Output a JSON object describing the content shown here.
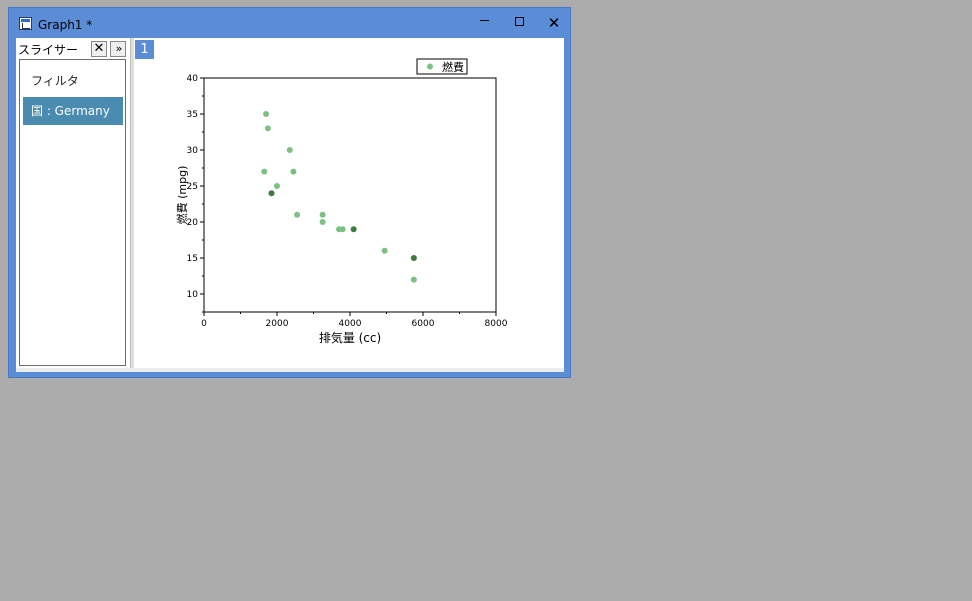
{
  "window": {
    "title": "Graph1 *",
    "min_glyph": "",
    "max_glyph": "",
    "close_glyph": "✕"
  },
  "slicer": {
    "title": "スライサー",
    "close_label": "✕",
    "expand_label": "»",
    "filter_label": "フィルタ",
    "selected_item": "国 : Germany"
  },
  "graph": {
    "layer_label": "1"
  },
  "colors": {
    "window_frame": "#5b8cd6",
    "point_light": "#7dc082",
    "point_dark": "#3f7a3a",
    "selection": "#4a8bb0"
  },
  "chart_data": {
    "type": "scatter",
    "xlabel": "排気量 (cc)",
    "ylabel": "燃費 (mpg)",
    "xlim": [
      0,
      8000
    ],
    "ylim": [
      7.5,
      40
    ],
    "xticks": [
      0,
      2000,
      4000,
      6000,
      8000
    ],
    "yticks": [
      10,
      15,
      20,
      25,
      30,
      35,
      40
    ],
    "legend": {
      "label": "燃費",
      "position": "top-right"
    },
    "series": [
      {
        "name": "燃費",
        "points": [
          {
            "x": 1700,
            "y": 35,
            "shade": "light"
          },
          {
            "x": 1750,
            "y": 33,
            "shade": "light"
          },
          {
            "x": 2350,
            "y": 30,
            "shade": "light"
          },
          {
            "x": 1650,
            "y": 27,
            "shade": "light"
          },
          {
            "x": 2450,
            "y": 27,
            "shade": "light"
          },
          {
            "x": 2000,
            "y": 25,
            "shade": "light"
          },
          {
            "x": 1850,
            "y": 24,
            "shade": "dark"
          },
          {
            "x": 2550,
            "y": 21,
            "shade": "light"
          },
          {
            "x": 3250,
            "y": 21,
            "shade": "light"
          },
          {
            "x": 3250,
            "y": 20,
            "shade": "light"
          },
          {
            "x": 3700,
            "y": 19,
            "shade": "light"
          },
          {
            "x": 3800,
            "y": 19,
            "shade": "light"
          },
          {
            "x": 4100,
            "y": 19,
            "shade": "dark"
          },
          {
            "x": 4950,
            "y": 16,
            "shade": "light"
          },
          {
            "x": 5750,
            "y": 15,
            "shade": "dark"
          },
          {
            "x": 5750,
            "y": 12,
            "shade": "light"
          }
        ]
      }
    ]
  }
}
